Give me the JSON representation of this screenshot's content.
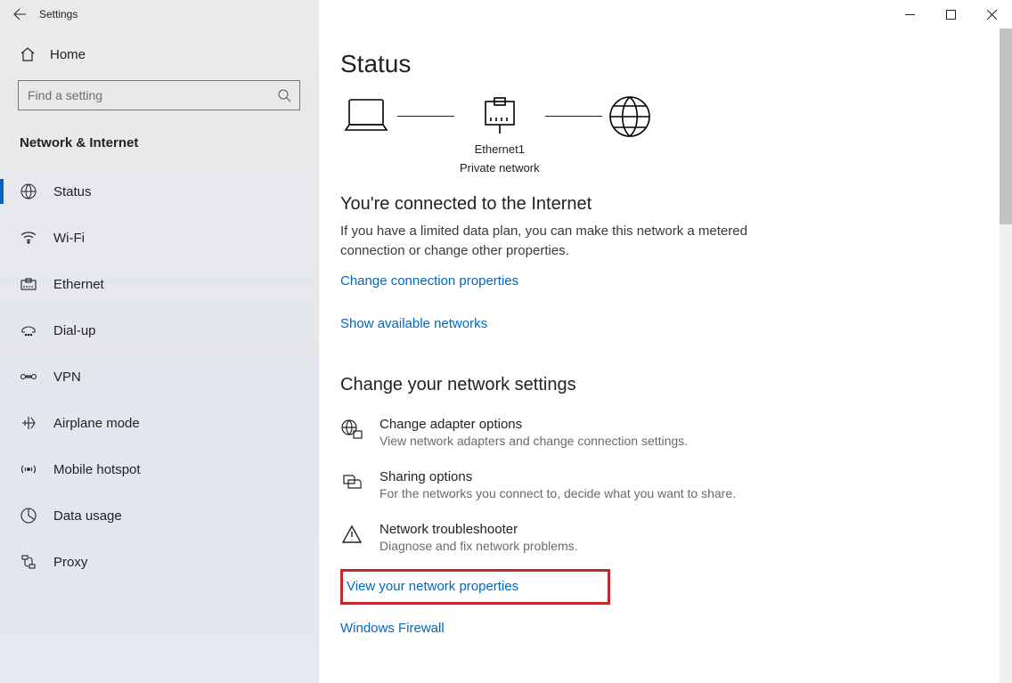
{
  "app_title": "Settings",
  "home_label": "Home",
  "search": {
    "placeholder": "Find a setting"
  },
  "section_heading": "Network & Internet",
  "nav": [
    {
      "key": "status",
      "label": "Status"
    },
    {
      "key": "wifi",
      "label": "Wi-Fi"
    },
    {
      "key": "ethernet",
      "label": "Ethernet"
    },
    {
      "key": "dialup",
      "label": "Dial-up"
    },
    {
      "key": "vpn",
      "label": "VPN"
    },
    {
      "key": "airplane",
      "label": "Airplane mode"
    },
    {
      "key": "hotspot",
      "label": "Mobile hotspot"
    },
    {
      "key": "data",
      "label": "Data usage"
    },
    {
      "key": "proxy",
      "label": "Proxy"
    }
  ],
  "page": {
    "title": "Status",
    "diagram": {
      "name": "Ethernet1",
      "profile": "Private network"
    },
    "connected": {
      "heading": "You're connected to the Internet",
      "desc": "If you have a limited data plan, you can make this network a metered connection or change other properties.",
      "change_link": "Change connection properties",
      "show_link": "Show available networks"
    },
    "change_section": {
      "heading": "Change your network settings",
      "items": [
        {
          "title": "Change adapter options",
          "desc": "View network adapters and change connection settings."
        },
        {
          "title": "Sharing options",
          "desc": "For the networks you connect to, decide what you want to share."
        },
        {
          "title": "Network troubleshooter",
          "desc": "Diagnose and fix network problems."
        }
      ],
      "view_props": "View your network properties",
      "firewall": "Windows Firewall"
    }
  }
}
